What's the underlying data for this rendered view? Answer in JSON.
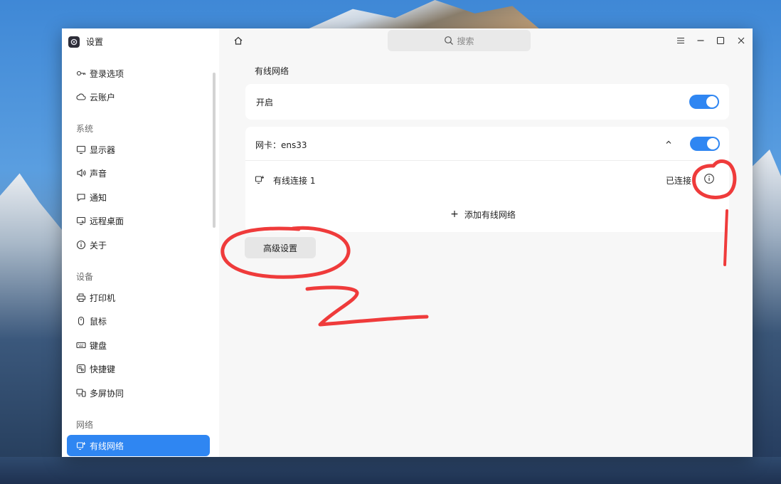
{
  "app": {
    "title": "设置"
  },
  "search": {
    "placeholder": "搜索"
  },
  "sidebar": {
    "items_top": [
      {
        "label": "登录选项",
        "icon": "key-icon"
      },
      {
        "label": "云账户",
        "icon": "cloud-icon"
      }
    ],
    "section_system": "系统",
    "items_system": [
      {
        "label": "显示器",
        "icon": "monitor-icon"
      },
      {
        "label": "声音",
        "icon": "speaker-icon"
      },
      {
        "label": "通知",
        "icon": "chat-bubble-icon"
      },
      {
        "label": "远程桌面",
        "icon": "remote-desktop-icon"
      },
      {
        "label": "关于",
        "icon": "info-icon"
      }
    ],
    "section_device": "设备",
    "items_device": [
      {
        "label": "打印机",
        "icon": "printer-icon"
      },
      {
        "label": "鼠标",
        "icon": "mouse-icon"
      },
      {
        "label": "键盘",
        "icon": "keyboard-icon"
      },
      {
        "label": "快捷键",
        "icon": "shortcut-icon"
      },
      {
        "label": "多屏协同",
        "icon": "multi-screen-icon"
      }
    ],
    "section_network": "网络",
    "items_network": [
      {
        "label": "有线网络",
        "icon": "wired-network-icon",
        "active": true
      }
    ]
  },
  "main": {
    "title": "有线网络",
    "enable_label": "开启",
    "enable_on": true,
    "adapter_label": "网卡：ens33",
    "adapter_on": true,
    "connection_name": "有线连接 1",
    "connection_status": "已连接",
    "add_label": "添加有线网络",
    "advanced_label": "高级设置"
  },
  "colors": {
    "accent": "#2f86f2",
    "annotation": "#ef3b3b"
  }
}
